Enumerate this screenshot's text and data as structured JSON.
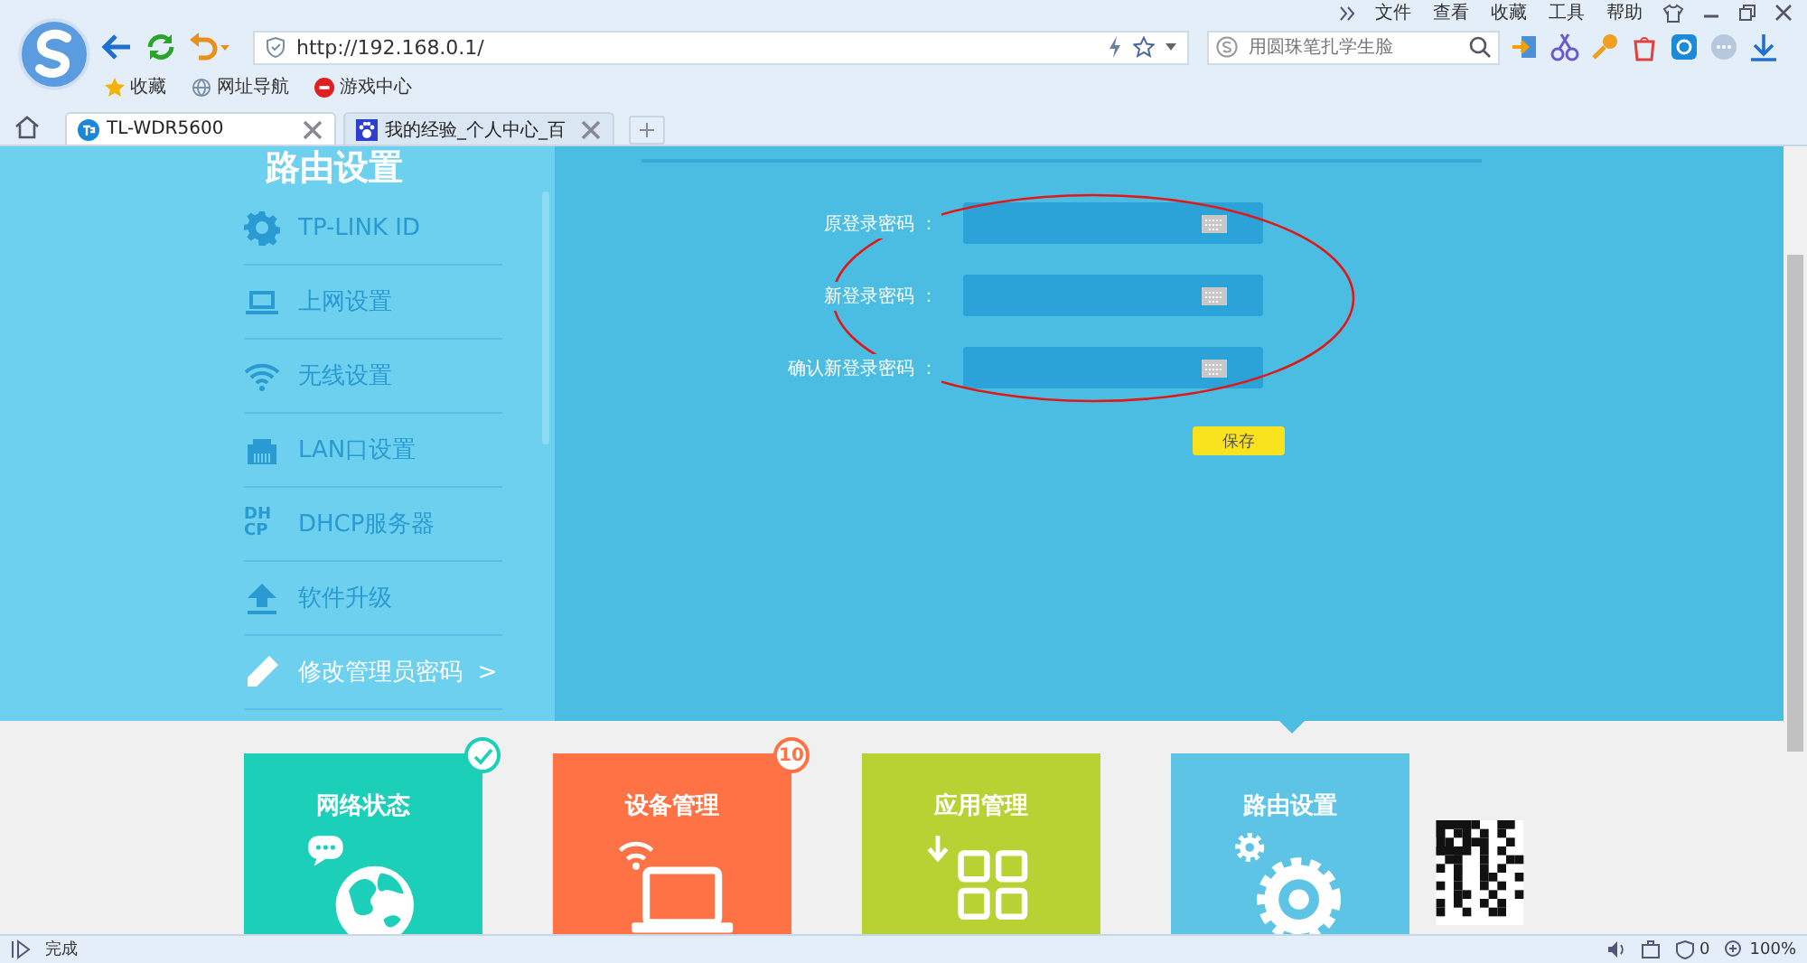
{
  "browser": {
    "menu": [
      "文件",
      "查看",
      "收藏",
      "工具",
      "帮助"
    ],
    "address": "http://192.168.0.1/",
    "search_placeholder": "用圆珠笔扎学生脸",
    "bookmarks": [
      {
        "label": "收藏"
      },
      {
        "label": "网址导航"
      },
      {
        "label": "游戏中心"
      }
    ],
    "tabs": [
      {
        "title": "TL-WDR5600",
        "selected": true
      },
      {
        "title": "我的经验_个人中心_百",
        "selected": false
      }
    ]
  },
  "page": {
    "heading": "路由设置",
    "sidebar": [
      {
        "label": "TP-LINK ID",
        "selected": false
      },
      {
        "label": "上网设置",
        "selected": false
      },
      {
        "label": "无线设置",
        "selected": false
      },
      {
        "label": "LAN口设置",
        "selected": false
      },
      {
        "label": "DHCP服务器",
        "icon_lines": [
          "DH",
          "CP"
        ],
        "selected": false
      },
      {
        "label": "软件升级",
        "selected": false
      },
      {
        "label": "修改管理员密码",
        "suffix": ">",
        "selected": true
      }
    ],
    "form": {
      "fields": [
        {
          "label": "原登录密码 ："
        },
        {
          "label": "新登录密码 ："
        },
        {
          "label": "确认新登录密码 ："
        }
      ],
      "save_button": "保存"
    },
    "tiles": [
      {
        "title": "网络状态",
        "color": "#1ccfb8",
        "badge": {
          "kind": "check"
        }
      },
      {
        "title": "设备管理",
        "color": "#ff7245",
        "badge": {
          "kind": "count",
          "text": "10"
        }
      },
      {
        "title": "应用管理",
        "color": "#b8d233"
      },
      {
        "title": "路由设置",
        "color": "#5ec4e6"
      }
    ]
  },
  "status_bar": {
    "text": "完成",
    "blocked_count": "0",
    "zoom": "100%"
  }
}
